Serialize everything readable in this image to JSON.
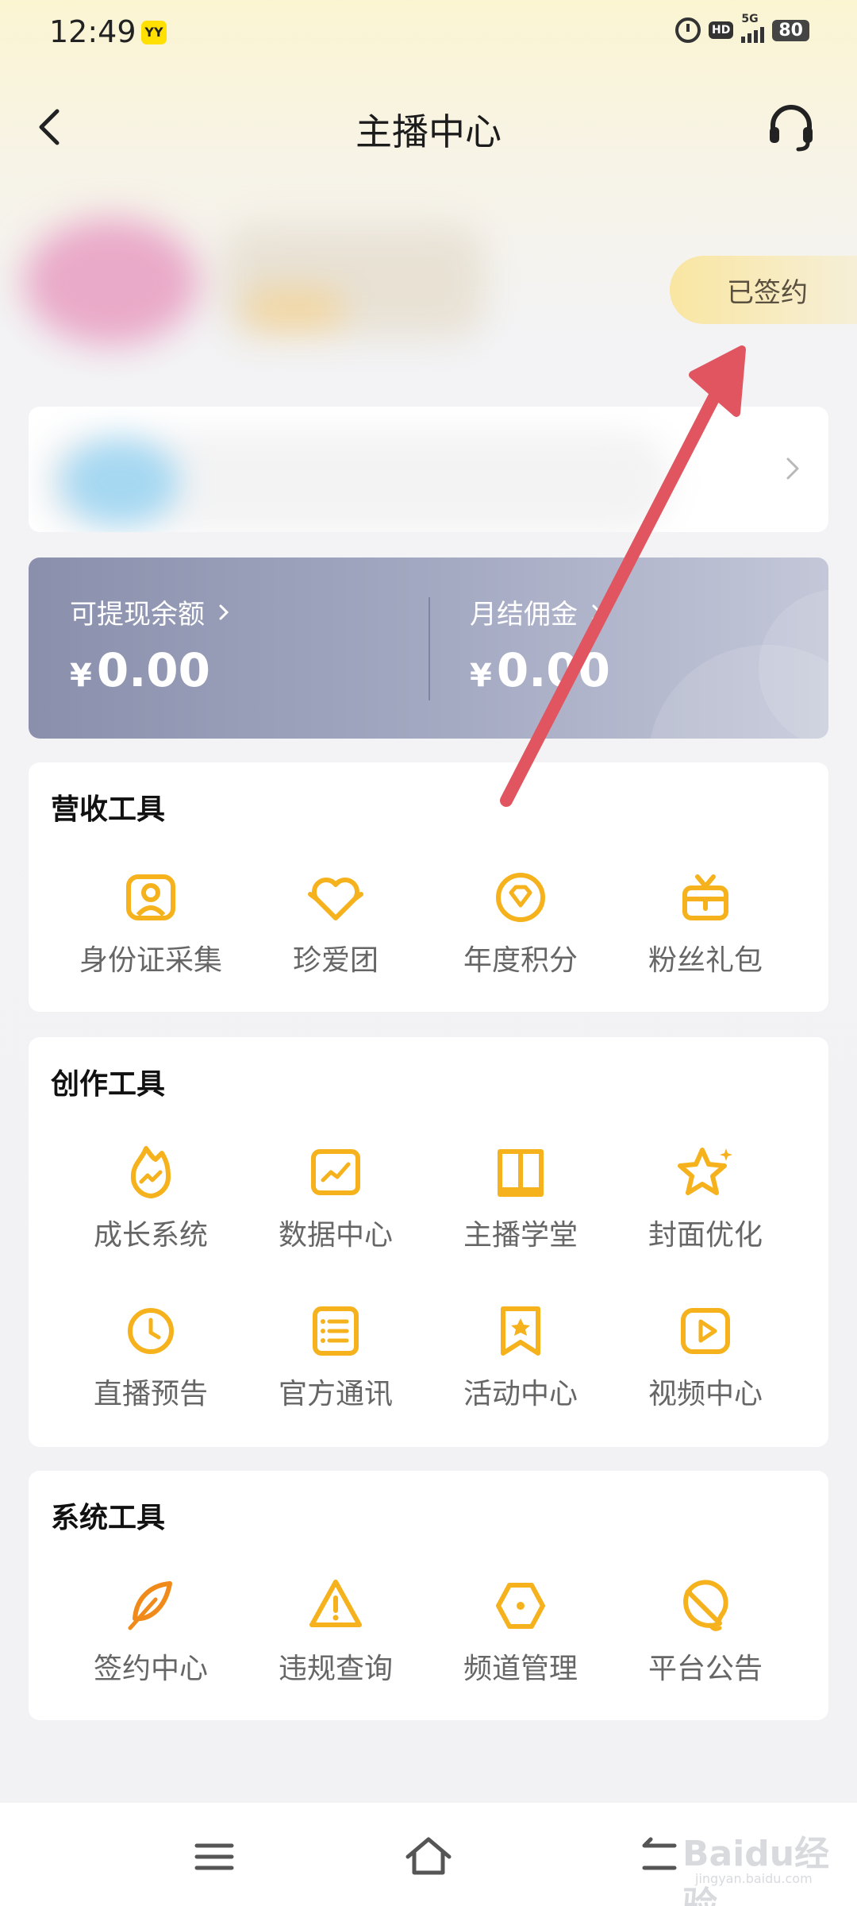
{
  "status_bar": {
    "time": "12:49",
    "app_badge": "YY",
    "hd_label": "HD",
    "network_label": "5G",
    "battery": "80",
    "icons": [
      "alarm-icon",
      "hd-icon",
      "signal-icon",
      "battery-icon"
    ]
  },
  "header": {
    "title": "主播中心",
    "back_icon": "chevron-left-icon",
    "support_icon": "headset-icon"
  },
  "profile": {
    "signed_badge": "已签约"
  },
  "balance": {
    "withdrawable_label": "可提现余额",
    "withdrawable_value": "0.00",
    "monthly_label": "月结佣金",
    "monthly_value": "0.00",
    "currency": "¥"
  },
  "revenue_tools": {
    "title": "营收工具",
    "items": [
      {
        "label": "身份证采集",
        "icon": "id-card-icon"
      },
      {
        "label": "珍爱团",
        "icon": "heart-crown-icon"
      },
      {
        "label": "年度积分",
        "icon": "diamond-icon"
      },
      {
        "label": "粉丝礼包",
        "icon": "gift-icon"
      }
    ]
  },
  "creation_tools": {
    "title": "创作工具",
    "items": [
      {
        "label": "成长系统",
        "icon": "flame-chart-icon"
      },
      {
        "label": "数据中心",
        "icon": "line-chart-icon"
      },
      {
        "label": "主播学堂",
        "icon": "book-icon"
      },
      {
        "label": "封面优化",
        "icon": "star-sparkle-icon"
      },
      {
        "label": "直播预告",
        "icon": "clock-icon"
      },
      {
        "label": "官方通讯",
        "icon": "list-icon"
      },
      {
        "label": "活动中心",
        "icon": "bookmark-star-icon"
      },
      {
        "label": "视频中心",
        "icon": "video-play-icon"
      }
    ]
  },
  "system_tools": {
    "title": "系统工具",
    "items": [
      {
        "label": "签约中心",
        "icon": "feather-icon"
      },
      {
        "label": "违规查询",
        "icon": "warning-icon"
      },
      {
        "label": "频道管理",
        "icon": "hexagon-icon"
      },
      {
        "label": "平台公告",
        "icon": "bell-icon"
      }
    ]
  },
  "bottom_nav": {
    "icons": [
      "menu-icon",
      "home-icon",
      "back-icon"
    ]
  },
  "watermark": {
    "logo": "Baidu经验",
    "url": "jingyan.baidu.com"
  },
  "colors": {
    "accent": "#f5b21c",
    "annotation_arrow": "#e05560",
    "balance_card": "#9aa0bb"
  }
}
